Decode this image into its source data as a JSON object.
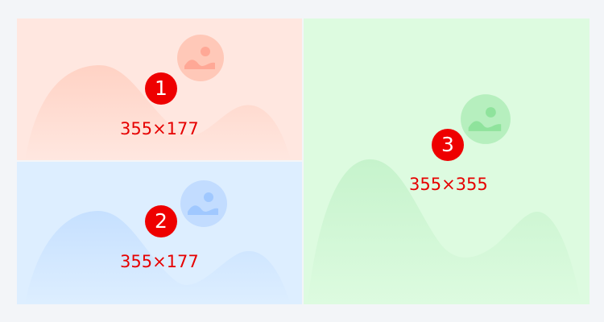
{
  "tiles": [
    {
      "number": "1",
      "dimensions": "355×177",
      "color": "#ffe7e0"
    },
    {
      "number": "2",
      "dimensions": "355×177",
      "color": "#ddeeff"
    },
    {
      "number": "3",
      "dimensions": "355×355",
      "color": "#ddfbe0"
    }
  ],
  "icons": {
    "placeholder": "image-placeholder-icon"
  },
  "colors": {
    "page_background": "#f3f5f8",
    "badge": "#ee0000",
    "dimension_text": "#e60000"
  }
}
